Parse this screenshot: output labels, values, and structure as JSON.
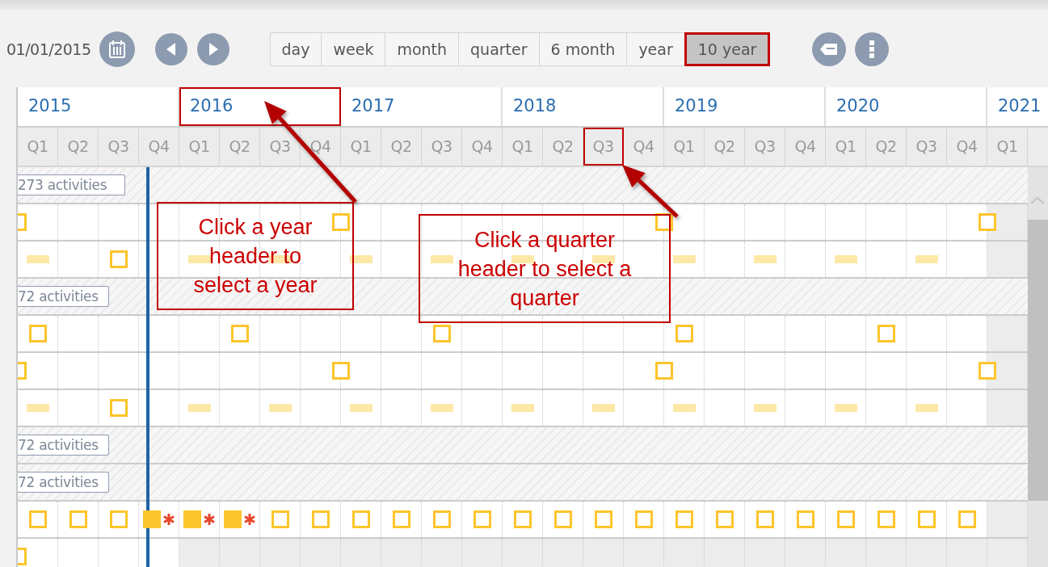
{
  "toolbar": {
    "date": "01/01/2015",
    "modes": [
      {
        "label": "day",
        "selected": false,
        "highlighted": false
      },
      {
        "label": "week",
        "selected": false,
        "highlighted": false
      },
      {
        "label": "month",
        "selected": false,
        "highlighted": false
      },
      {
        "label": "quarter",
        "selected": false,
        "highlighted": false
      },
      {
        "label": "6 month",
        "selected": false,
        "highlighted": false
      },
      {
        "label": "year",
        "selected": false,
        "highlighted": false
      },
      {
        "label": "10 year",
        "selected": true,
        "highlighted": true
      }
    ]
  },
  "years": [
    {
      "label": "2015",
      "highlighted": false
    },
    {
      "label": "2016",
      "highlighted": true
    },
    {
      "label": "2017",
      "highlighted": false
    },
    {
      "label": "2018",
      "highlighted": false
    },
    {
      "label": "2019",
      "highlighted": false
    },
    {
      "label": "2020",
      "highlighted": false
    },
    {
      "label": "2021",
      "highlighted": false
    }
  ],
  "quarters": [
    {
      "label": "Q1",
      "highlighted": false
    },
    {
      "label": "Q2",
      "highlighted": false
    },
    {
      "label": "Q3",
      "highlighted": false
    },
    {
      "label": "Q4",
      "highlighted": false
    },
    {
      "label": "Q1",
      "highlighted": false
    },
    {
      "label": "Q2",
      "highlighted": false
    },
    {
      "label": "Q3",
      "highlighted": false
    },
    {
      "label": "Q4",
      "highlighted": false
    },
    {
      "label": "Q1",
      "highlighted": false
    },
    {
      "label": "Q2",
      "highlighted": false
    },
    {
      "label": "Q3",
      "highlighted": false
    },
    {
      "label": "Q4",
      "highlighted": false
    },
    {
      "label": "Q1",
      "highlighted": false
    },
    {
      "label": "Q2",
      "highlighted": false
    },
    {
      "label": "Q3",
      "highlighted": true
    },
    {
      "label": "Q4",
      "highlighted": false
    },
    {
      "label": "Q1",
      "highlighted": false
    },
    {
      "label": "Q2",
      "highlighted": false
    },
    {
      "label": "Q3",
      "highlighted": false
    },
    {
      "label": "Q4",
      "highlighted": false
    },
    {
      "label": "Q1",
      "highlighted": false
    },
    {
      "label": "Q2",
      "highlighted": false
    },
    {
      "label": "Q3",
      "highlighted": false
    },
    {
      "label": "Q4",
      "highlighted": false
    },
    {
      "label": "Q1",
      "highlighted": false
    }
  ],
  "rows": [
    {
      "kind": "group",
      "label": "273 activities"
    },
    {
      "kind": "track",
      "cells": [
        {
          "kind": "boundary"
        },
        {
          "kind": "empty"
        },
        {
          "kind": "empty"
        },
        {
          "kind": "empty"
        },
        {
          "kind": "empty"
        },
        {
          "kind": "empty"
        },
        {
          "kind": "empty"
        },
        {
          "kind": "empty"
        },
        {
          "kind": "boundary"
        },
        {
          "kind": "empty"
        },
        {
          "kind": "empty"
        },
        {
          "kind": "empty"
        },
        {
          "kind": "empty"
        },
        {
          "kind": "empty"
        },
        {
          "kind": "empty"
        },
        {
          "kind": "empty"
        },
        {
          "kind": "boundary"
        },
        {
          "kind": "empty"
        },
        {
          "kind": "empty"
        },
        {
          "kind": "empty"
        },
        {
          "kind": "empty"
        },
        {
          "kind": "empty"
        },
        {
          "kind": "empty"
        },
        {
          "kind": "empty"
        },
        {
          "kind": "boundary"
        }
      ]
    },
    {
      "kind": "track",
      "cells": [
        {
          "kind": "bar"
        },
        {
          "kind": "empty"
        },
        {
          "kind": "open"
        },
        {
          "kind": "empty"
        },
        {
          "kind": "bar"
        },
        {
          "kind": "empty"
        },
        {
          "kind": "bar"
        },
        {
          "kind": "empty"
        },
        {
          "kind": "bar"
        },
        {
          "kind": "empty"
        },
        {
          "kind": "bar"
        },
        {
          "kind": "empty"
        },
        {
          "kind": "bar"
        },
        {
          "kind": "empty"
        },
        {
          "kind": "bar"
        },
        {
          "kind": "empty"
        },
        {
          "kind": "bar"
        },
        {
          "kind": "empty"
        },
        {
          "kind": "bar"
        },
        {
          "kind": "empty"
        },
        {
          "kind": "bar"
        },
        {
          "kind": "empty"
        },
        {
          "kind": "bar"
        },
        {
          "kind": "empty"
        },
        {
          "kind": "empty"
        }
      ]
    },
    {
      "kind": "group",
      "label": "72 activities"
    },
    {
      "kind": "track",
      "cells": [
        {
          "kind": "open"
        },
        {
          "kind": "empty"
        },
        {
          "kind": "empty"
        },
        {
          "kind": "empty"
        },
        {
          "kind": "empty"
        },
        {
          "kind": "open"
        },
        {
          "kind": "empty"
        },
        {
          "kind": "empty"
        },
        {
          "kind": "empty"
        },
        {
          "kind": "empty"
        },
        {
          "kind": "open"
        },
        {
          "kind": "empty"
        },
        {
          "kind": "empty"
        },
        {
          "kind": "empty"
        },
        {
          "kind": "empty"
        },
        {
          "kind": "empty"
        },
        {
          "kind": "open"
        },
        {
          "kind": "empty"
        },
        {
          "kind": "empty"
        },
        {
          "kind": "empty"
        },
        {
          "kind": "empty"
        },
        {
          "kind": "open"
        },
        {
          "kind": "empty"
        },
        {
          "kind": "empty"
        },
        {
          "kind": "empty"
        }
      ]
    },
    {
      "kind": "track",
      "cells": [
        {
          "kind": "boundary"
        },
        {
          "kind": "empty"
        },
        {
          "kind": "empty"
        },
        {
          "kind": "empty"
        },
        {
          "kind": "empty"
        },
        {
          "kind": "empty"
        },
        {
          "kind": "empty"
        },
        {
          "kind": "empty"
        },
        {
          "kind": "boundary"
        },
        {
          "kind": "empty"
        },
        {
          "kind": "empty"
        },
        {
          "kind": "empty"
        },
        {
          "kind": "empty"
        },
        {
          "kind": "empty"
        },
        {
          "kind": "empty"
        },
        {
          "kind": "empty"
        },
        {
          "kind": "boundary"
        },
        {
          "kind": "empty"
        },
        {
          "kind": "empty"
        },
        {
          "kind": "empty"
        },
        {
          "kind": "empty"
        },
        {
          "kind": "empty"
        },
        {
          "kind": "empty"
        },
        {
          "kind": "empty"
        },
        {
          "kind": "boundary"
        }
      ]
    },
    {
      "kind": "track",
      "cells": [
        {
          "kind": "bar"
        },
        {
          "kind": "empty"
        },
        {
          "kind": "open"
        },
        {
          "kind": "empty"
        },
        {
          "kind": "bar"
        },
        {
          "kind": "empty"
        },
        {
          "kind": "bar"
        },
        {
          "kind": "empty"
        },
        {
          "kind": "bar"
        },
        {
          "kind": "empty"
        },
        {
          "kind": "bar"
        },
        {
          "kind": "empty"
        },
        {
          "kind": "bar"
        },
        {
          "kind": "empty"
        },
        {
          "kind": "bar"
        },
        {
          "kind": "empty"
        },
        {
          "kind": "bar"
        },
        {
          "kind": "empty"
        },
        {
          "kind": "bar"
        },
        {
          "kind": "empty"
        },
        {
          "kind": "bar"
        },
        {
          "kind": "empty"
        },
        {
          "kind": "bar"
        },
        {
          "kind": "empty"
        },
        {
          "kind": "empty"
        }
      ]
    },
    {
      "kind": "group",
      "label": "72 activities"
    },
    {
      "kind": "group",
      "label": "72 activities"
    },
    {
      "kind": "track",
      "cells": [
        {
          "kind": "open"
        },
        {
          "kind": "open"
        },
        {
          "kind": "open"
        },
        {
          "kind": "done"
        },
        {
          "kind": "done"
        },
        {
          "kind": "done"
        },
        {
          "kind": "open"
        },
        {
          "kind": "open"
        },
        {
          "kind": "open"
        },
        {
          "kind": "open"
        },
        {
          "kind": "open"
        },
        {
          "kind": "open"
        },
        {
          "kind": "open"
        },
        {
          "kind": "open"
        },
        {
          "kind": "open"
        },
        {
          "kind": "open"
        },
        {
          "kind": "open"
        },
        {
          "kind": "open"
        },
        {
          "kind": "open"
        },
        {
          "kind": "open"
        },
        {
          "kind": "open"
        },
        {
          "kind": "open"
        },
        {
          "kind": "open"
        },
        {
          "kind": "open"
        },
        {
          "kind": "empty"
        }
      ]
    },
    {
      "kind": "track",
      "cells": [
        {
          "kind": "boundary"
        },
        {
          "kind": "empty"
        },
        {
          "kind": "empty"
        },
        {
          "kind": "empty"
        },
        {
          "kind": "off"
        },
        {
          "kind": "off"
        },
        {
          "kind": "off"
        },
        {
          "kind": "off"
        },
        {
          "kind": "off"
        },
        {
          "kind": "off"
        },
        {
          "kind": "off"
        },
        {
          "kind": "off"
        },
        {
          "kind": "off"
        },
        {
          "kind": "off"
        },
        {
          "kind": "off"
        },
        {
          "kind": "off"
        },
        {
          "kind": "off"
        },
        {
          "kind": "off"
        },
        {
          "kind": "off"
        },
        {
          "kind": "off"
        },
        {
          "kind": "off"
        },
        {
          "kind": "off"
        },
        {
          "kind": "off"
        },
        {
          "kind": "off"
        },
        {
          "kind": "off"
        }
      ]
    }
  ],
  "annotations": [
    {
      "text": "Click a year header to select a year"
    },
    {
      "text": "Click a quarter header to select a quarter"
    }
  ]
}
